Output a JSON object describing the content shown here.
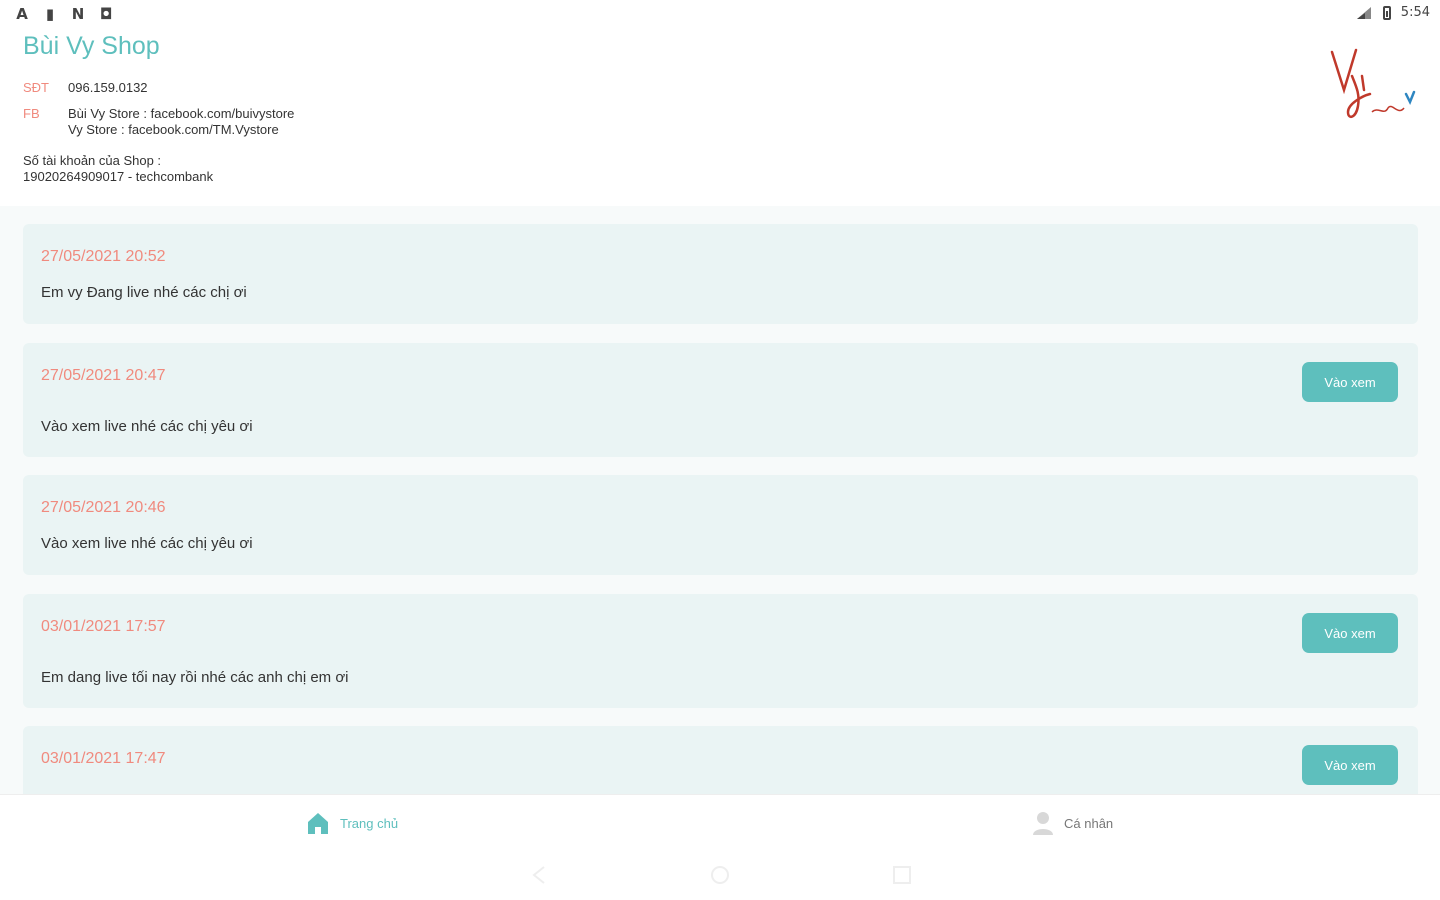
{
  "status_bar": {
    "time": "5:54",
    "left_icons": [
      "A",
      "▮",
      "N",
      "◘"
    ]
  },
  "header": {
    "shop_name": "Bùi Vy Shop",
    "phone_label": "SĐT",
    "phone_value": "096.159.0132",
    "fb_label": "FB",
    "fb_line1": "Bùi Vy Store : facebook.com/buivystore",
    "fb_line2": "Vy Store : facebook.com/TM.Vystore",
    "account_label": "Số tài khoản của Shop :",
    "account_value": "19020264909017 - techcombank"
  },
  "feed": {
    "items": [
      {
        "date": "27/05/2021 20:52",
        "message": "Em vy Đang live nhé các chị ơi",
        "button": null
      },
      {
        "date": "27/05/2021 20:47",
        "message": "Vào xem live nhé các chị yêu ơi",
        "button": "Vào xem"
      },
      {
        "date": "27/05/2021 20:46",
        "message": "Vào xem live nhé các chị yêu ơi",
        "button": null
      },
      {
        "date": "03/01/2021 17:57",
        "message": "Em dang live tối nay rồi nhé các anh chị em ơi",
        "button": "Vào xem"
      },
      {
        "date": "03/01/2021 17:47",
        "message": "",
        "button": "Vào xem"
      }
    ]
  },
  "bottom_nav": {
    "home_label": "Trang chủ",
    "profile_label": "Cá nhân"
  },
  "colors": {
    "accent": "#5ebfbd",
    "date": "#f08a7e",
    "card_bg": "#eaf4f4"
  }
}
